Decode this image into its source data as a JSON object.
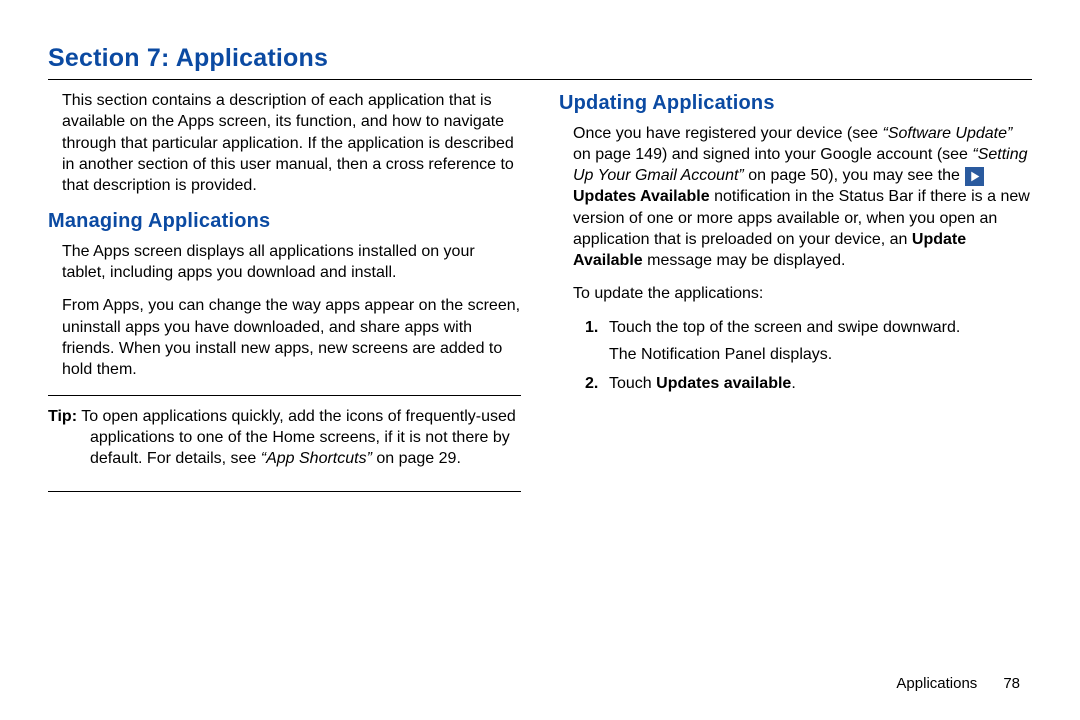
{
  "section_title": "Section 7: Applications",
  "left": {
    "intro": "This section contains a description of each application that is available on the Apps screen, its function, and how to navigate through that particular application. If the application is described in another section of this user manual, then a cross reference to that description is provided.",
    "subhead": "Managing Applications",
    "p1": "The Apps screen displays all applications installed on your tablet, including apps you download and install.",
    "p2": "From Apps, you can change the way apps appear on the screen, uninstall apps you have downloaded, and share apps with friends. When you install new apps, new screens are added to hold them.",
    "tip_label": "Tip:",
    "tip_lead": " To open applications quickly, add the icons of frequently-used applications to one of the Home screens, if it is not there by default. For details, see ",
    "tip_ref": "“App Shortcuts”",
    "tip_tail": " on page 29."
  },
  "right": {
    "subhead": "Updating Applications",
    "p1_a": "Once you have registered your device (see ",
    "ref1": "“Software Update”",
    "p1_b": " on page 149) and signed into your Google account (see ",
    "ref2": "“Setting Up Your Gmail Account”",
    "p1_c": " on page 50), you may see the ",
    "bold1": "Updates Available",
    "p1_d": " notification in the Status Bar if there is a new version of one or more apps available or, when you open an application that is preloaded on your device, an ",
    "bold2": "Update Available",
    "p1_e": " message may be displayed.",
    "p2": "To update the applications:",
    "li1_a": "Touch the top of the screen and swipe downward.",
    "li1_b": "The Notification Panel displays.",
    "li2_a": "Touch ",
    "li2_b": "Updates available",
    "li2_c": "."
  },
  "footer": {
    "chapter": "Applications",
    "page": "78"
  },
  "numbers": {
    "one": "1.",
    "two": "2."
  }
}
